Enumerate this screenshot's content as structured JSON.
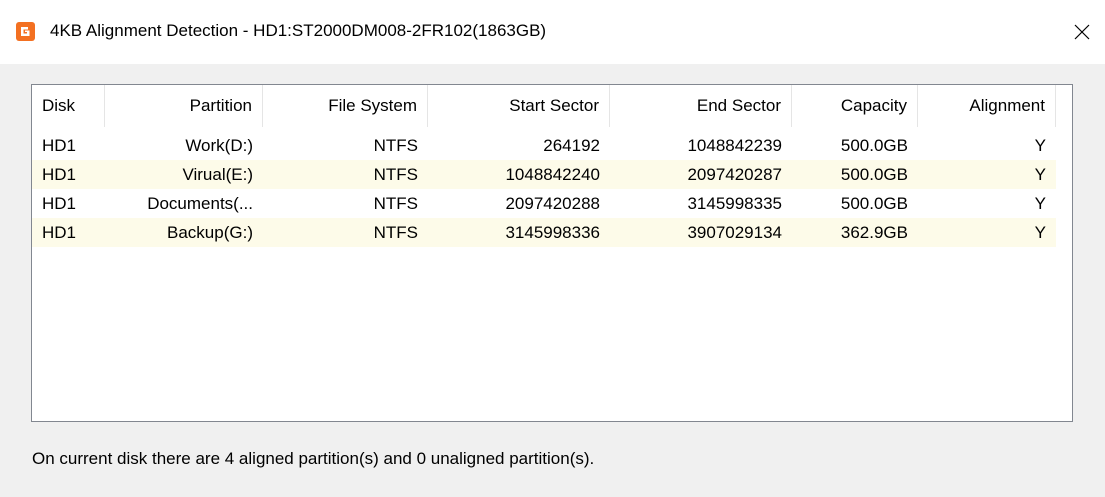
{
  "window": {
    "title": "4KB Alignment Detection - HD1:ST2000DM008-2FR102(1863GB)",
    "app_icon": "diskgenius-logo-icon",
    "close_icon": "close-icon",
    "accent_color": "#f37021"
  },
  "table": {
    "columns": [
      "Disk",
      "Partition",
      "File System",
      "Start Sector",
      "End Sector",
      "Capacity",
      "Alignment"
    ],
    "rows": [
      [
        "HD1",
        "Work(D:)",
        "NTFS",
        "264192",
        "1048842239",
        "500.0GB",
        "Y"
      ],
      [
        "HD1",
        "Virual(E:)",
        "NTFS",
        "1048842240",
        "2097420287",
        "500.0GB",
        "Y"
      ],
      [
        "HD1",
        "Documents(...",
        "NTFS",
        "2097420288",
        "3145998335",
        "500.0GB",
        "Y"
      ],
      [
        "HD1",
        "Backup(G:)",
        "NTFS",
        "3145998336",
        "3907029134",
        "362.9GB",
        "Y"
      ]
    ],
    "alt_row_color": "#fdfbe9"
  },
  "status": {
    "message": "On current disk there are 4 aligned partition(s) and 0 unaligned partition(s)."
  }
}
